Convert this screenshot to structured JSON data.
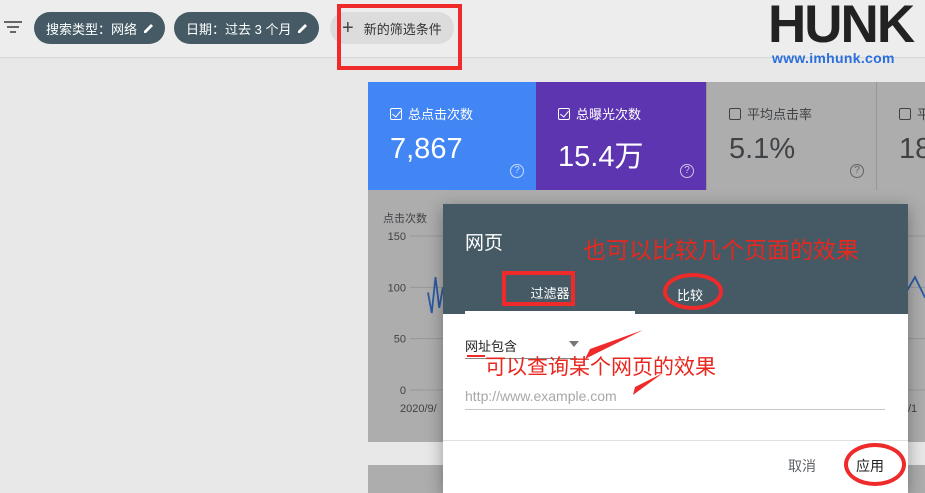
{
  "filters": {
    "chips": [
      {
        "label": "搜索类型：网络"
      },
      {
        "label": "日期：过去 3 个月"
      }
    ],
    "add_label": "新的筛选条件"
  },
  "logo": {
    "brand": "HUNK",
    "url": "www.imhunk.com"
  },
  "metrics": [
    {
      "label": "总点击次数",
      "value": "7,867",
      "checked": true,
      "color": "#4285f4"
    },
    {
      "label": "总曝光次数",
      "value": "15.4万",
      "checked": true,
      "color": "#5e35b1"
    },
    {
      "label": "平均点击率",
      "value": "5.1%",
      "checked": false
    },
    {
      "label": "平",
      "value": "18",
      "checked": false
    }
  ],
  "chart_data": {
    "type": "line",
    "ylabel": "点击次数",
    "yticks": [
      "150",
      "100",
      "50",
      "0"
    ],
    "ylim": [
      0,
      150
    ],
    "xlabel_start": "2020/9/",
    "xlabel_end": "/1",
    "series": [
      {
        "values": [
          95,
          75,
          110,
          80,
          100
        ]
      }
    ]
  },
  "dialog": {
    "title": "网页",
    "tabs": [
      {
        "label": "过滤器",
        "active": true
      },
      {
        "label": "比较",
        "active": false
      }
    ],
    "select_value": "网址包含",
    "input_placeholder": "http://www.example.com",
    "input_value": "",
    "cancel_label": "取消",
    "apply_label": "应用"
  },
  "annotations": {
    "top": "也可以比较几个页面的效果",
    "middle": "可以查询某个网页的效果"
  },
  "colors": {
    "chip_bg": "#455a64",
    "clicks": "#4285f4",
    "impressions": "#5e35b1",
    "annotation_red": "#ee2a2a"
  }
}
